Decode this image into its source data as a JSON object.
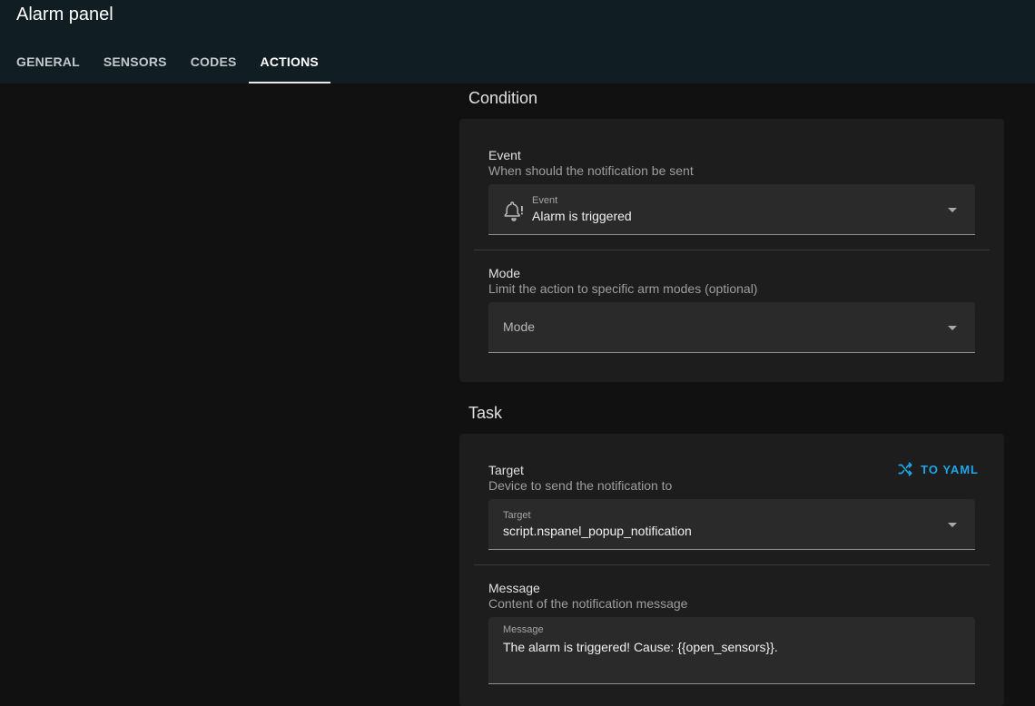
{
  "header": {
    "title": "Alarm panel",
    "tabs": [
      {
        "label": "GENERAL"
      },
      {
        "label": "SENSORS"
      },
      {
        "label": "CODES"
      },
      {
        "label": "ACTIONS"
      }
    ]
  },
  "condition": {
    "title": "Condition",
    "event": {
      "label": "Event",
      "description": "When should the notification be sent",
      "select_label": "Event",
      "select_value": "Alarm is triggered",
      "icon": "bell-alert-icon"
    },
    "mode": {
      "label": "Mode",
      "description": "Limit the action to specific arm modes (optional)",
      "placeholder": "Mode"
    }
  },
  "task": {
    "title": "Task",
    "yaml_button": "TO YAML",
    "target": {
      "label": "Target",
      "description": "Device to send the notification to",
      "select_label": "Target",
      "select_value": "script.nspanel_popup_notification"
    },
    "message": {
      "label": "Message",
      "description": "Content of the notification message",
      "input_label": "Message",
      "input_value": "The alarm is triggered! Cause: {{open_sensors}}."
    }
  },
  "colors": {
    "header_bg": "#101e24",
    "page_bg": "#111111",
    "card_bg": "#1d1d1d",
    "accent": "#1fa5e8"
  }
}
